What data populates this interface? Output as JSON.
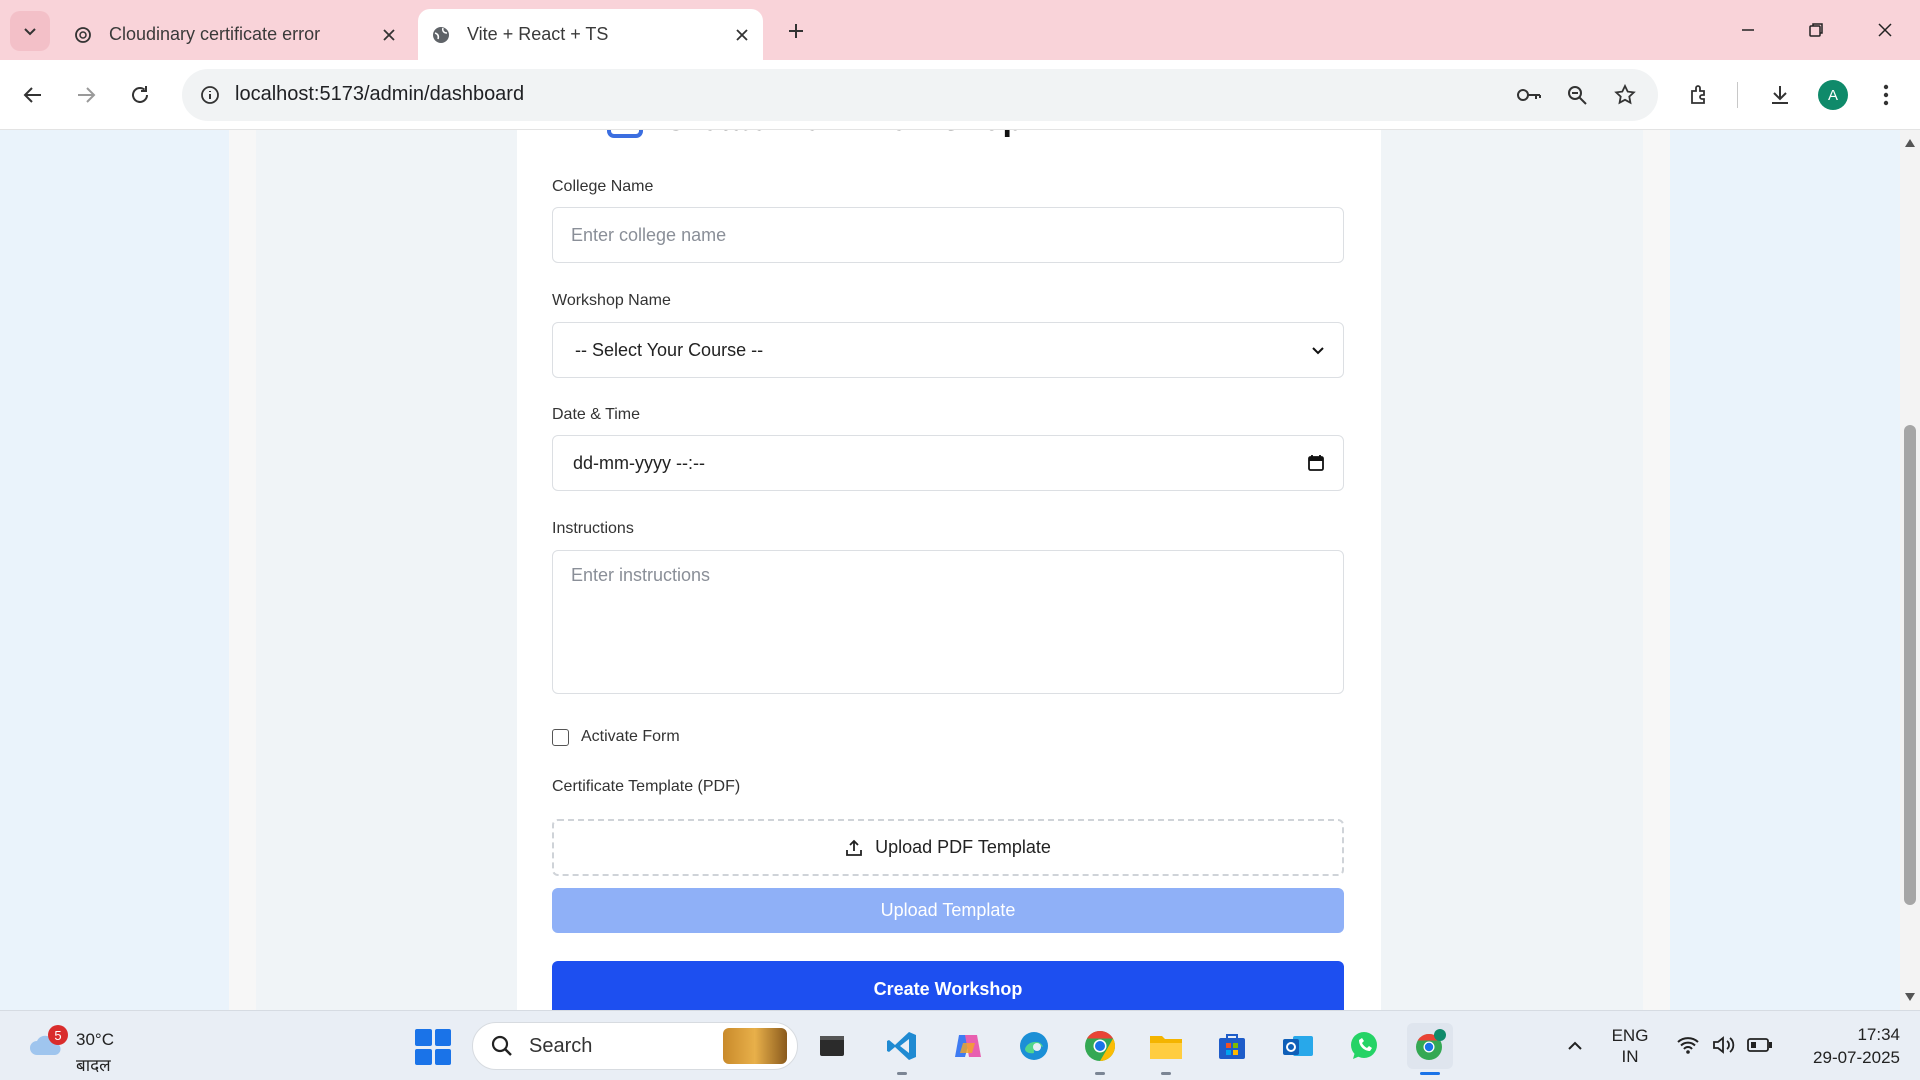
{
  "browser": {
    "tabs": [
      {
        "title": "Cloudinary certificate error",
        "active": false,
        "icon": "openai-icon"
      },
      {
        "title": "Vite + React + TS",
        "active": true,
        "icon": "globe-icon"
      }
    ],
    "url": "localhost:5173/admin/dashboard",
    "profile_initial": "A"
  },
  "form": {
    "title": "Create New Workshop",
    "college_label": "College Name",
    "college_placeholder": "Enter college name",
    "workshop_label": "Workshop Name",
    "workshop_selected": "-- Select Your Course --",
    "datetime_label": "Date & Time",
    "datetime_value": "dd-mm-yyyy --:--",
    "instructions_label": "Instructions",
    "instructions_placeholder": "Enter instructions",
    "activate_label": "Activate Form",
    "activate_checked": false,
    "template_label": "Certificate Template (PDF)",
    "upload_pdf_label": "Upload PDF Template",
    "upload_template_button": "Upload Template",
    "create_button": "Create Workshop"
  },
  "taskbar": {
    "weather_badge": "5",
    "temperature": "30°C",
    "condition": "बादल",
    "search_label": "Search",
    "lang_top": "ENG",
    "lang_bottom": "IN",
    "time": "17:34",
    "date": "29-07-2025"
  },
  "colors": {
    "primary": "#1d4ff0",
    "primary_disabled": "#8fb0f7",
    "tabbar": "#f9d3d9",
    "page_bg": "#eaf3fb"
  }
}
